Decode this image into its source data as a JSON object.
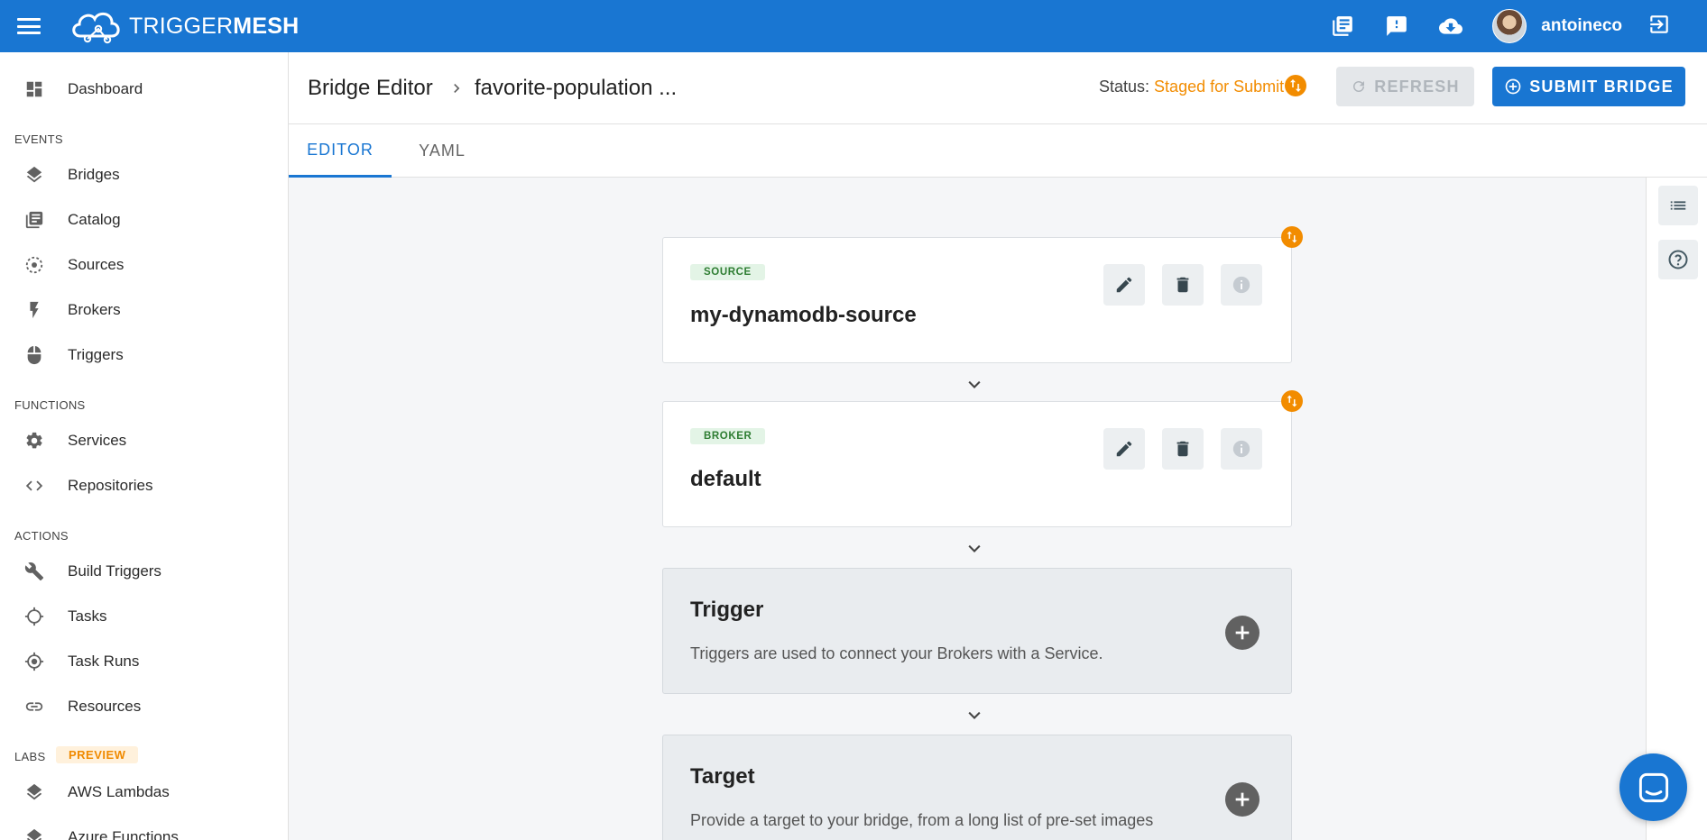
{
  "topbar": {
    "logo_light": "TRIGGER",
    "logo_bold": "MESH",
    "username": "antoineco",
    "icons": [
      "docs-icon",
      "feedback-icon",
      "download-icon",
      "logout-icon"
    ]
  },
  "sidebar": {
    "dashboard": "Dashboard",
    "sections": {
      "events": "EVENTS",
      "functions": "FUNCTIONS",
      "actions": "ACTIONS",
      "labs": "LABS"
    },
    "labs_badge": "PREVIEW",
    "events_items": [
      "Bridges",
      "Catalog",
      "Sources",
      "Brokers",
      "Triggers"
    ],
    "functions_items": [
      "Services",
      "Repositories"
    ],
    "actions_items": [
      "Build Triggers",
      "Tasks",
      "Task Runs",
      "Resources"
    ],
    "labs_items": [
      "AWS Lambdas",
      "Azure Functions"
    ]
  },
  "header": {
    "breadcrumb_root": "Bridge Editor",
    "breadcrumb_current": "favorite-population ...",
    "status_label": "Status:",
    "status_value": "Staged for Submit",
    "refresh_label": "REFRESH",
    "submit_label": "SUBMIT BRIDGE"
  },
  "tabs": {
    "editor": "EDITOR",
    "yaml": "YAML",
    "active": "EDITOR"
  },
  "bridge": {
    "source": {
      "tag": "SOURCE",
      "name": "my-dynamodb-source"
    },
    "broker": {
      "tag": "BROKER",
      "name": "default"
    },
    "trigger": {
      "title": "Trigger",
      "description": "Triggers are used to connect your Brokers with a Service."
    },
    "target": {
      "title": "Target",
      "description": "Provide a target to your bridge, from a long list of pre-set images"
    }
  },
  "colors": {
    "primary": "#1976d2",
    "status_orange": "#f28c00",
    "tag_green": "#2e7d32"
  }
}
